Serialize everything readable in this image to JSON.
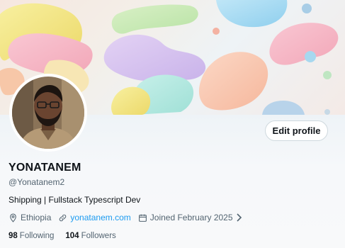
{
  "profile": {
    "display_name": "YONATANEM",
    "handle": "@Yonatanem2",
    "bio": "Shipping | Fullstack Typescript Dev",
    "location": "Ethiopia",
    "website": "yonatanem.com",
    "joined": "Joined February 2025",
    "following_count": "98",
    "following_label": "Following",
    "followers_count": "104",
    "followers_label": "Followers"
  },
  "actions": {
    "edit_profile_label": "Edit profile"
  },
  "icons": {
    "location": "location-pin-icon",
    "link": "link-icon",
    "calendar": "calendar-icon",
    "chevron": "chevron-right-icon"
  },
  "colors": {
    "accent": "#1d9bf0",
    "text": "#0f1419",
    "muted": "#536471"
  }
}
